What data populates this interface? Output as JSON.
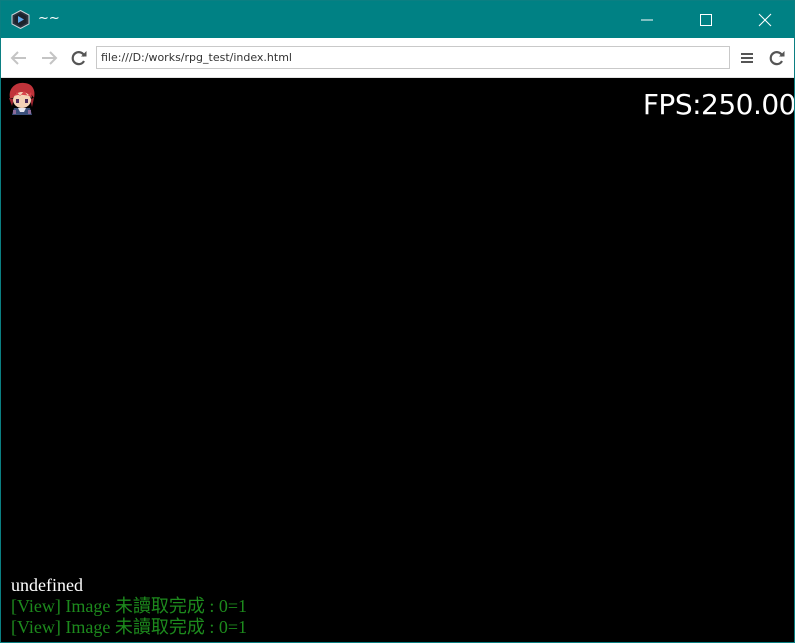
{
  "window": {
    "title": "~~",
    "titlebar_color": "#008184"
  },
  "icons": {
    "app": "app-logo-icon",
    "minimize": "minimize-icon",
    "maximize": "maximize-icon",
    "close": "close-icon",
    "back": "arrow-left-icon",
    "forward": "arrow-right-icon",
    "reload": "reload-icon",
    "menu": "hamburger-menu-icon"
  },
  "navbar": {
    "url": "file:///D:/works/rpg_test/index.html"
  },
  "game": {
    "background": "#000000",
    "fps_text": "FPS:250.00",
    "sprite": "character-sprite"
  },
  "console": {
    "lines": [
      {
        "text": "undefined",
        "color": "#ffffff"
      },
      {
        "text": "[View] Image 未讀取完成 : 0=1",
        "color": "#1d8a1d"
      },
      {
        "text": "[View] Image 未讀取完成 : 0=1",
        "color": "#1d8a1d"
      }
    ]
  }
}
